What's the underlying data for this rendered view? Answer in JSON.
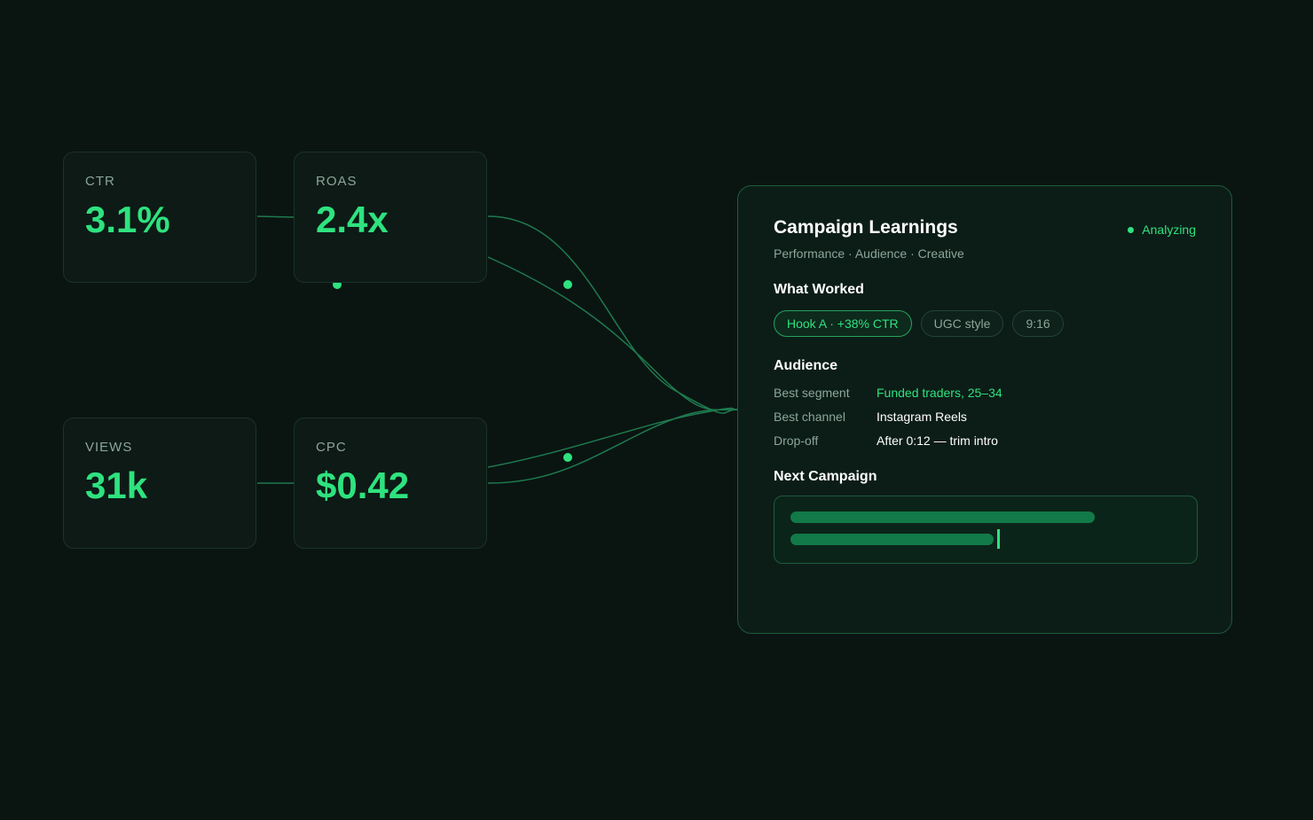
{
  "metrics": {
    "ctr": {
      "label": "CTR",
      "value": "3.1%"
    },
    "roas": {
      "label": "ROAS",
      "value": "2.4x"
    },
    "views": {
      "label": "VIEWS",
      "value": "31k"
    },
    "cpc": {
      "label": "CPC",
      "value": "$0.42"
    }
  },
  "panel": {
    "title": "Campaign Learnings",
    "subtitle": "Performance · Audience · Creative",
    "status": "Analyzing",
    "what_worked": {
      "heading": "What Worked",
      "chips": [
        "Hook A · +38% CTR",
        "UGC style",
        "9:16"
      ]
    },
    "audience": {
      "heading": "Audience",
      "rows": [
        {
          "key": "Best segment",
          "value": "Funded traders, 25–34"
        },
        {
          "key": "Best channel",
          "value": "Instagram Reels"
        },
        {
          "key": "Drop-off",
          "value": "After 0:12 — trim intro"
        }
      ]
    },
    "next_campaign": {
      "heading": "Next Campaign"
    }
  },
  "colors": {
    "background": "#0a1512",
    "accent": "#2fe27f",
    "connector": "#1f7a4e",
    "panel_border": "#1e5a3c"
  }
}
